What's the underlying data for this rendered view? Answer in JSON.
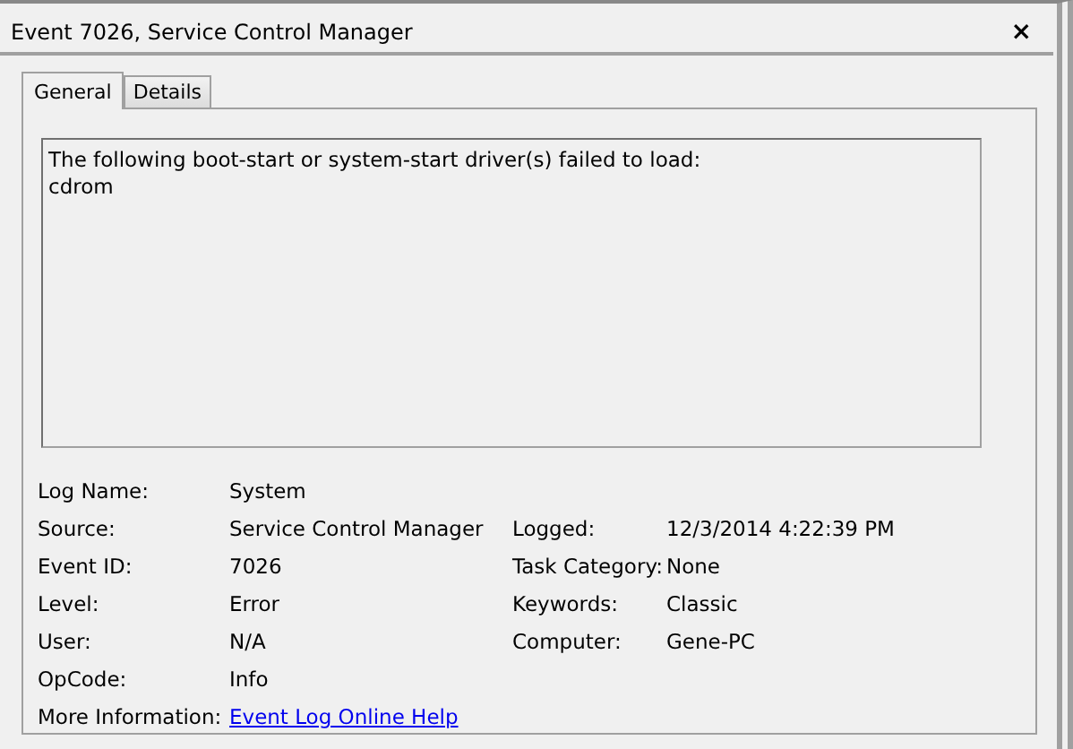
{
  "window": {
    "title": "Event 7026, Service Control Manager",
    "close": "×"
  },
  "tabs": [
    {
      "label": "General",
      "selected": true
    },
    {
      "label": "Details",
      "selected": false
    }
  ],
  "message": {
    "lines": [
      "The following boot-start or system-start driver(s) failed to load:",
      "cdrom"
    ]
  },
  "fields": [
    {
      "label": "Log Name:",
      "value": "System"
    },
    {
      "label": "Source:",
      "value": "Service Control Manager",
      "right_label": "Logged:",
      "right_value": "12/3/2014 4:22:39 PM"
    },
    {
      "label": "Event ID:",
      "value": "7026",
      "right_label": "Task Category:",
      "right_value": "None"
    },
    {
      "label": "Level:",
      "value": "Error",
      "right_label": "Keywords:",
      "right_value": "Classic"
    },
    {
      "label": "User:",
      "value": "N/A",
      "right_label": "Computer:",
      "right_value": "Gene-PC"
    },
    {
      "label": "OpCode:",
      "value": "Info"
    },
    {
      "label": "More Information:",
      "value": "Event Log Online Help",
      "kind": "link"
    }
  ]
}
